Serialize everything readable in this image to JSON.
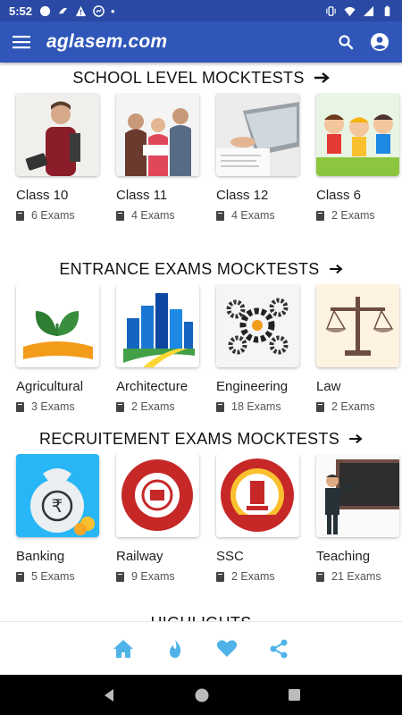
{
  "status_bar": {
    "time": "5:52",
    "dot": "•"
  },
  "app_bar": {
    "logo": "aglasem.com"
  },
  "sections": {
    "school": {
      "title": "SCHOOL LEVEL MOCKTESTS",
      "cards": [
        {
          "label": "Class 10",
          "count": "6 Exams"
        },
        {
          "label": "Class 11",
          "count": "4 Exams"
        },
        {
          "label": "Class 12",
          "count": "4 Exams"
        },
        {
          "label": "Class 6",
          "count": "2 Exams"
        }
      ]
    },
    "entrance": {
      "title": "ENTRANCE EXAMS MOCKTESTS",
      "cards": [
        {
          "label": "Agricultural",
          "count": "3 Exams"
        },
        {
          "label": "Architecture",
          "count": "2 Exams"
        },
        {
          "label": "Engineering",
          "count": "18 Exams"
        },
        {
          "label": "Law",
          "count": "2 Exams"
        }
      ]
    },
    "recruitment": {
      "title": "RECRUITEMENT EXAMS MOCKTESTS",
      "cards": [
        {
          "label": "Banking",
          "count": "5 Exams"
        },
        {
          "label": "Railway",
          "count": "9 Exams"
        },
        {
          "label": "SSC",
          "count": "2 Exams"
        },
        {
          "label": "Teaching",
          "count": "21 Exams"
        }
      ]
    },
    "highlights": {
      "title": "HIGHLIGHTS"
    }
  },
  "bottom_nav": [
    "home-icon",
    "flame-icon",
    "heart-icon",
    "share-icon"
  ],
  "colors": {
    "status_bar": "#2a49a4",
    "app_bar": "#2f56b8",
    "accent_nav": "#4fb3e8"
  }
}
